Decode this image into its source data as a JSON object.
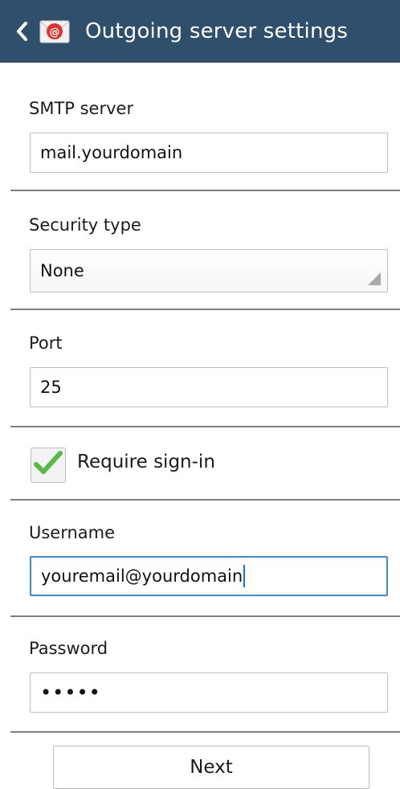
{
  "header": {
    "title": "Outgoing server settings",
    "back_icon": "chevron-left-icon",
    "app_icon": "email-app-icon",
    "bg_color": "#2f4f6c"
  },
  "smtp": {
    "label": "SMTP server",
    "value": "mail.yourdomain"
  },
  "security": {
    "label": "Security type",
    "value": "None"
  },
  "port": {
    "label": "Port",
    "value": "25"
  },
  "signin": {
    "label": "Require sign-in",
    "checked": true,
    "check_color": "#58b947"
  },
  "username": {
    "label": "Username",
    "value": "youremail@yourdomain"
  },
  "password": {
    "label": "Password",
    "value": "•••••"
  },
  "next_label": "Next"
}
